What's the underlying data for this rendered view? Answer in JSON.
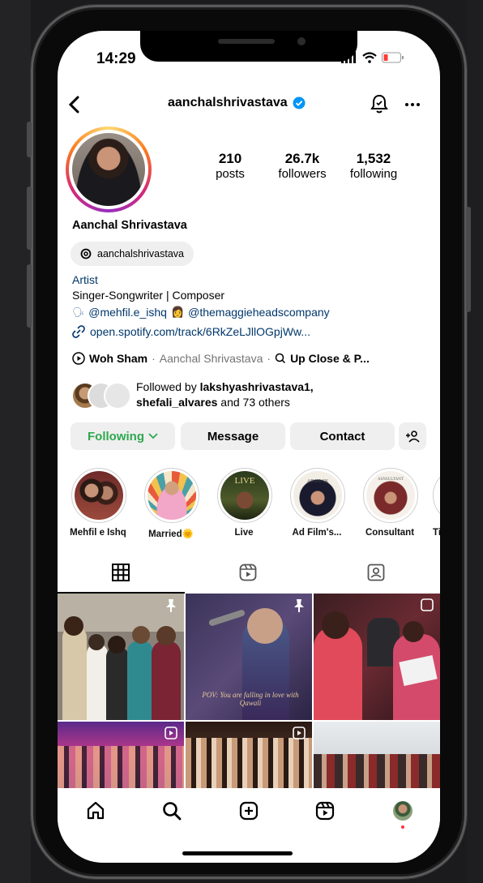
{
  "status_bar": {
    "time": "14:29"
  },
  "profile": {
    "username": "aanchalshrivastava",
    "display_name": "Aanchal Shrivastava",
    "threads_handle": "aanchalshrivastava",
    "category": "Artist",
    "bio_line": "Singer-Songwriter | Composer",
    "mention_1": "@mehfil.e_ishq",
    "mention_2": "@themaggieheadscompany",
    "link": "open.spotify.com/track/6RkZeLJllOGpjWw...",
    "music_song": "Woh Sham",
    "music_artist": "Aanchal Shrivastava",
    "music_extra": "Up Close & P...",
    "followed_by_prefix": "Followed by ",
    "followed_by_user": "lakshyashrivastava1,",
    "followed_by_user2": "shefali_alvares",
    "followed_by_suffix": " and 73 others"
  },
  "stats": {
    "posts": {
      "value": "210",
      "label": "posts"
    },
    "followers": {
      "value": "26.7k",
      "label": "followers"
    },
    "following": {
      "value": "1,532",
      "label": "following"
    }
  },
  "actions": {
    "following": "Following",
    "message": "Message",
    "contact": "Contact"
  },
  "highlights": [
    {
      "label": "Mehfil e Ishq"
    },
    {
      "label": "Married🌞"
    },
    {
      "label": "Live"
    },
    {
      "label": "Ad Film's..."
    },
    {
      "label": "Consultant"
    },
    {
      "label": "Ti"
    }
  ],
  "highlight_cover_text": {
    "live": "LIVE",
    "ad": "ADAILSK",
    "consult": "ASNSULTANT"
  },
  "post_caption": "POV: You are falling in love with Qawali",
  "colors": {
    "accent_blue": "#0095f6",
    "link_blue": "#00376b",
    "following_green": "#2fa84f",
    "notification_red": "#ff3040"
  },
  "icons": [
    "back-chevron-icon",
    "verified-badge-icon",
    "bell-icon",
    "more-icon",
    "threads-icon",
    "link-icon",
    "music-icon",
    "add-person-icon",
    "grid-icon",
    "reels-icon",
    "tagged-icon",
    "home-icon",
    "search-icon",
    "create-icon",
    "reels-nav-icon",
    "pin-icon"
  ]
}
